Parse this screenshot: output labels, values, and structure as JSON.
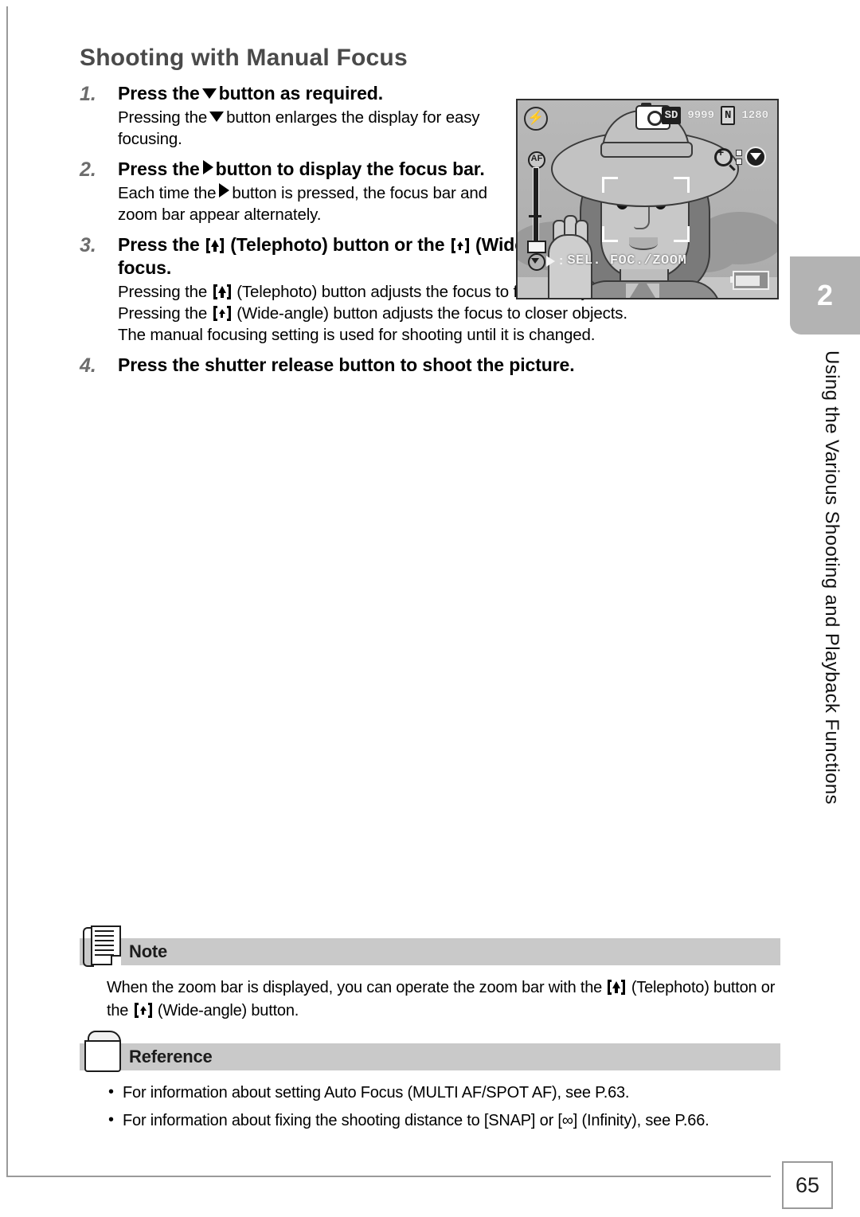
{
  "page": {
    "title": "Shooting with Manual Focus",
    "number": "65"
  },
  "chapter": {
    "number": "2",
    "vertical_title": "Using the Various Shooting and Playback Functions"
  },
  "steps": [
    {
      "number": "1.",
      "heading_before": "Press the",
      "heading_icon": "down-triangle",
      "heading_after": "button as required.",
      "desc_before": "Pressing the",
      "desc_icon": "down-triangle",
      "desc_after": "button enlarges the display for easy focusing."
    },
    {
      "number": "2.",
      "heading_before": "Press the",
      "heading_icon": "right-triangle",
      "heading_after": "button to display the focus bar.",
      "desc_before": "Each time the",
      "desc_icon": "right-triangle",
      "desc_after": "button is pressed, the focus bar and zoom bar appear alternately."
    },
    {
      "number": "3.",
      "heading_p1": "Press the",
      "heading_icon1": "telephoto-button",
      "heading_p2": "(Telephoto) button or the",
      "heading_icon2": "wide-angle-button",
      "heading_p3": "(Wide-angle) button to adjust the focus.",
      "desc_lines": [
        {
          "p1": "Pressing the",
          "icon": "telephoto-button",
          "p2": "(Telephoto) button adjusts the focus to farther objects."
        },
        {
          "p1": "Pressing the",
          "icon": "wide-angle-button",
          "p2": "(Wide-angle) button adjusts the focus to closer objects."
        },
        {
          "p1": "The manual focusing setting is used for shooting until it is changed.",
          "icon": "",
          "p2": ""
        }
      ]
    },
    {
      "number": "4.",
      "heading": "Press the shutter release button to shoot the picture."
    }
  ],
  "lcd": {
    "flash_icon": "flash-off-icon",
    "camera_icon": "camera-mode-icon",
    "status": [
      {
        "text": "SD",
        "style": "inv"
      },
      {
        "text": "9999",
        "style": "out"
      },
      {
        "text": "N",
        "style": "box"
      },
      {
        "text": "1280",
        "style": "out"
      }
    ],
    "magnify_icon": "magnify-plus-icon",
    "down_button_icon": "down-triangle-button-icon",
    "focus_bar_top_label": "AF",
    "hint_text": "SEL. FOC./ZOOM",
    "hint_arrow_icon": "right-triangle-icon",
    "battery_icon": "battery-indicator-icon"
  },
  "note": {
    "label": "Note",
    "icon": "note-document-icon",
    "p1": "When the zoom bar is displayed, you can operate the zoom bar with the",
    "icon1": "telephoto-button",
    "p2": "(Telephoto) button or the",
    "icon2": "wide-angle-button",
    "p3": "(Wide-angle) button."
  },
  "reference": {
    "label": "Reference",
    "icon": "reference-folder-icon",
    "items": [
      "For information about setting Auto Focus (MULTI AF/SPOT AF), see P.63.",
      "For information about fixing the shooting distance to [SNAP] or [∞] (Infinity), see P.66."
    ]
  },
  "colors": {
    "title_gray": "#4a4a4a",
    "step_number_gray": "#6d6d6d",
    "callout_bar": "#c9c9c9",
    "chapter_tab": "#b3b3b3",
    "frame": "#9a9a9a"
  }
}
